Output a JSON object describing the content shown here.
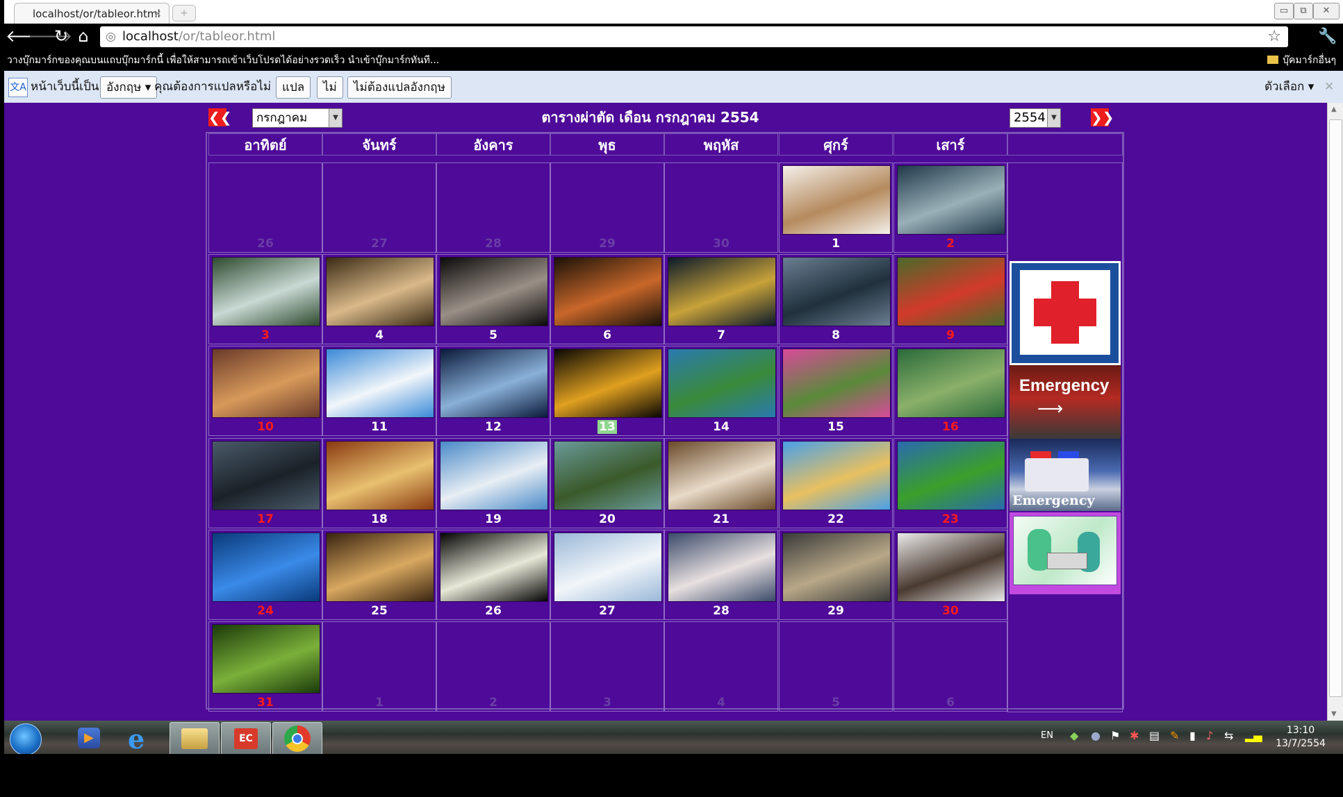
{
  "browser": {
    "tab_title": "localhost/or/tableor.html",
    "tab_close": "×",
    "new_tab": "+",
    "url_host": "localhost",
    "url_path": "/or/tableor.html",
    "window_controls": [
      "▭",
      "⧉",
      "✕"
    ],
    "bookmark_hint": "วางบุ๊กมาร์กของคุณบนแถบบุ๊กมาร์กนี้ เพื่อให้สามารถเข้าเว็บโปรดได้อย่างรวดเร็ว นำเข้าบุ๊กมาร์กทันที...",
    "other_bookmarks": "บุ๊คมาร์กอื่นๆ"
  },
  "translate_bar": {
    "page_is": "หน้าเว็บนี้เป็น",
    "language": "อังกฤษ ▾",
    "question": "คุณต้องการแปลหรือไม่",
    "translate": "แปล",
    "no": "ไม่",
    "never": "ไม่ต้องแปลอังกฤษ",
    "options": "ตัวเลือก ▾",
    "close": "✕"
  },
  "calendar": {
    "prev": "❮❮",
    "next": "❯❯",
    "month_selected": "กรกฎาคม",
    "year_selected": "2554",
    "title": "ตารางผ่าตัด   เดือน กรกฎาคม 2554",
    "weekdays": [
      "อาทิตย์",
      "จันทร์",
      "อังคาร",
      "พุธ",
      "พฤหัส",
      "ศุกร์",
      "เสาร์"
    ],
    "today": "13",
    "weeks": [
      [
        {
          "d": "26",
          "t": "other"
        },
        {
          "d": "27",
          "t": "other"
        },
        {
          "d": "28",
          "t": "other"
        },
        {
          "d": "29",
          "t": "other"
        },
        {
          "d": "30",
          "t": "other"
        },
        {
          "d": "1",
          "img": "rabbit",
          "c1": "#f4f0ea",
          "c2": "#b58a5e"
        },
        {
          "d": "2",
          "t": "sun",
          "img": "vet",
          "c1": "#20394a",
          "c2": "#9ab0b8"
        }
      ],
      [
        {
          "d": "3",
          "t": "sun",
          "img": "waterfall",
          "c1": "#2d4a2e",
          "c2": "#c9d9d4"
        },
        {
          "d": "4",
          "img": "fountain",
          "c1": "#3a2a14",
          "c2": "#d9b98a"
        },
        {
          "d": "5",
          "img": "man",
          "c1": "#0a0a0a",
          "c2": "#9a8f86"
        },
        {
          "d": "6",
          "img": "sunset",
          "c1": "#1a1208",
          "c2": "#c9672a"
        },
        {
          "d": "7",
          "img": "bridge",
          "c1": "#0b1a2a",
          "c2": "#c8a23a"
        },
        {
          "d": "8",
          "img": "lake",
          "c1": "#6a7e92",
          "c2": "#20303c"
        },
        {
          "d": "9",
          "t": "sun",
          "img": "car",
          "c1": "#4a6a2a",
          "c2": "#d23a2a"
        }
      ],
      [
        {
          "d": "10",
          "t": "sun",
          "img": "city",
          "c1": "#6a3a2a",
          "c2": "#d89a5a"
        },
        {
          "d": "11",
          "img": "heart",
          "c1": "#3a8ad8",
          "c2": "#f2f6fa"
        },
        {
          "d": "12",
          "img": "earth",
          "c1": "#0a1a3a",
          "c2": "#8ab0d8"
        },
        {
          "d": "13",
          "t": "today",
          "img": "eiffel",
          "c1": "#0a0804",
          "c2": "#e0a020"
        },
        {
          "d": "14",
          "img": "river",
          "c1": "#2a7ab0",
          "c2": "#3a8a3a"
        },
        {
          "d": "15",
          "img": "flowers",
          "c1": "#d84a9a",
          "c2": "#5a8a3a"
        },
        {
          "d": "16",
          "t": "sun",
          "img": "wall",
          "c1": "#2a6a3a",
          "c2": "#8ab06a"
        }
      ],
      [
        {
          "d": "17",
          "t": "sun",
          "img": "halo",
          "c1": "#4a5a6a",
          "c2": "#1a2228"
        },
        {
          "d": "18",
          "img": "blonde",
          "c1": "#8a3a10",
          "c2": "#e8c070"
        },
        {
          "d": "19",
          "img": "mountain",
          "c1": "#4a8ac8",
          "c2": "#e8eef4"
        },
        {
          "d": "20",
          "img": "rock",
          "c1": "#6a9a9a",
          "c2": "#3a5a2a"
        },
        {
          "d": "21",
          "img": "falls",
          "c1": "#6a4a2a",
          "c2": "#e8dac8"
        },
        {
          "d": "22",
          "img": "madagascar",
          "c1": "#4aa0e8",
          "c2": "#e8c060"
        },
        {
          "d": "23",
          "t": "sun",
          "img": "field",
          "c1": "#2a6ab0",
          "c2": "#3aa02a"
        }
      ],
      [
        {
          "d": "24",
          "t": "sun",
          "img": "skyline",
          "c1": "#0a3a7a",
          "c2": "#3a8ae8"
        },
        {
          "d": "25",
          "img": "galaxy",
          "c1": "#3a2410",
          "c2": "#d8a860"
        },
        {
          "d": "26",
          "img": "lily",
          "c1": "#050505",
          "c2": "#e8e8d8"
        },
        {
          "d": "27",
          "img": "snow",
          "c1": "#9ab8d8",
          "c2": "#f2f6fa"
        },
        {
          "d": "28",
          "img": "house",
          "c1": "#3a4a6a",
          "c2": "#e8e0e0"
        },
        {
          "d": "29",
          "img": "street",
          "c1": "#3a3a3a",
          "c2": "#b8a888"
        },
        {
          "d": "30",
          "t": "sun",
          "img": "actor",
          "c1": "#eaeaea",
          "c2": "#4a3a30"
        }
      ],
      [
        {
          "d": "31",
          "t": "sun",
          "img": "forest",
          "c1": "#1a3a0a",
          "c2": "#7ab03a"
        },
        {
          "d": "1",
          "t": "other"
        },
        {
          "d": "2",
          "t": "other"
        },
        {
          "d": "3",
          "t": "other"
        },
        {
          "d": "4",
          "t": "other"
        },
        {
          "d": "5",
          "t": "other"
        },
        {
          "d": "6",
          "t": "other"
        }
      ]
    ],
    "side": {
      "emergency_label": "Emergency",
      "sign_text": "Emergency",
      "sign_arrow": "⟶"
    }
  },
  "taskbar": {
    "lang": "EN",
    "time": "13:10",
    "date": "13/7/2554"
  },
  "colors": {
    "page_bg": "#4e0a98",
    "sunday": "#ff1a1a",
    "nav_arrow": "#ef1d1d"
  }
}
